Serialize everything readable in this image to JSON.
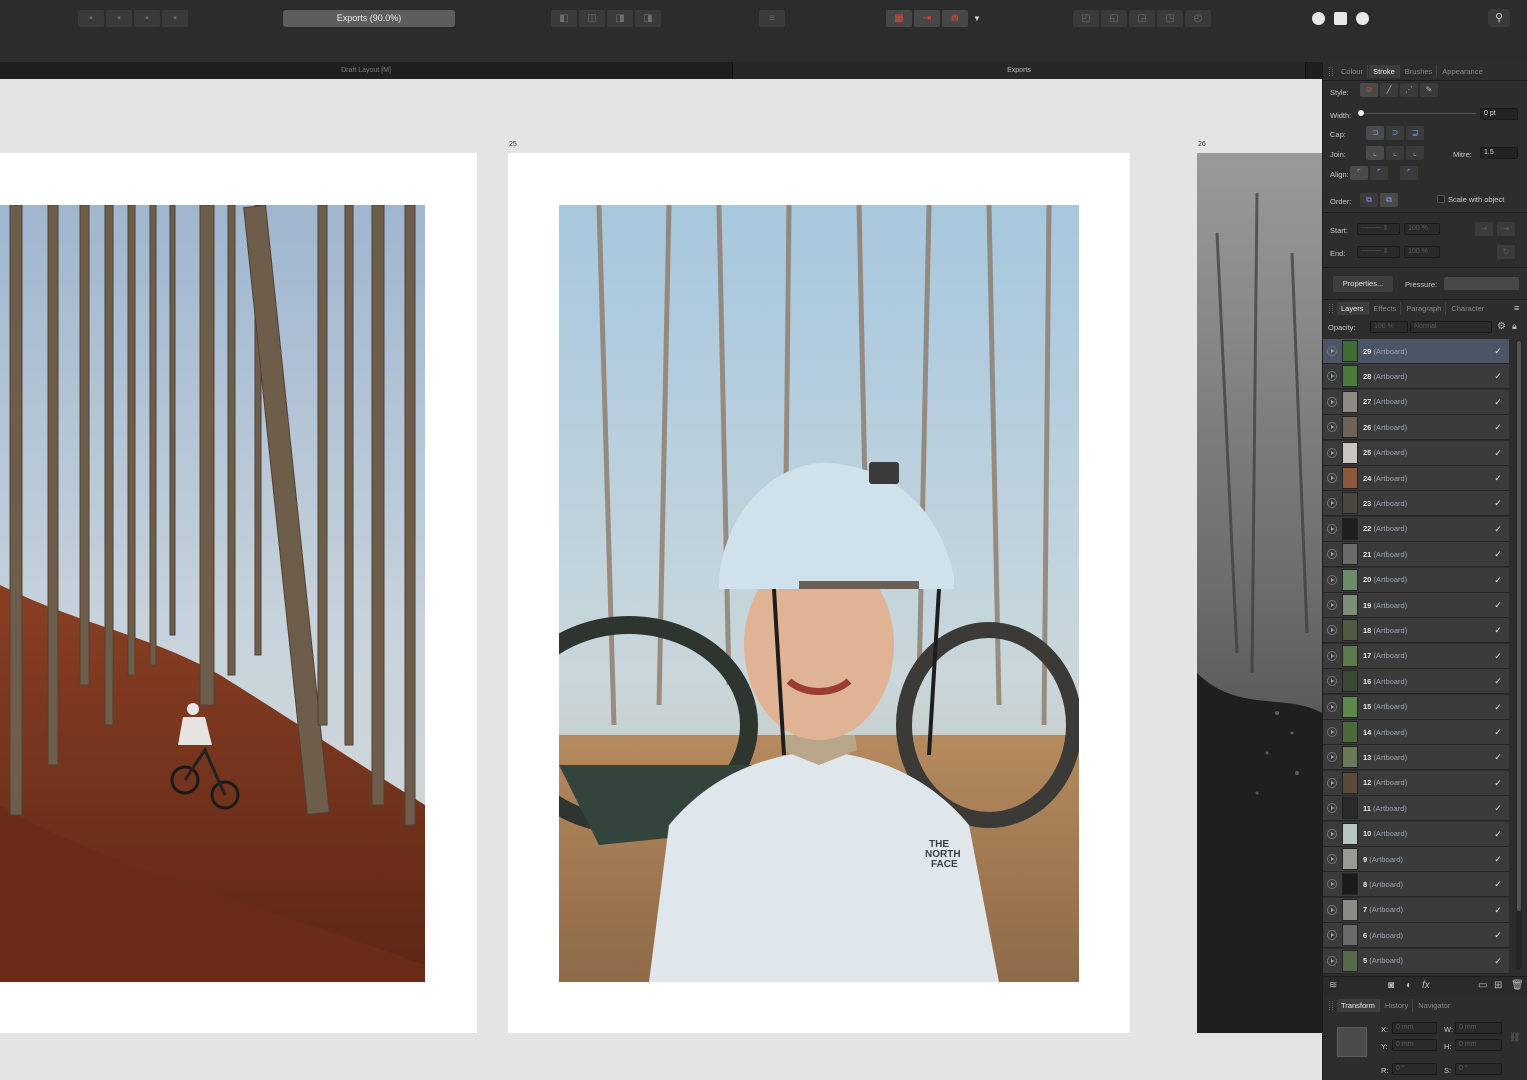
{
  "toolbar": {
    "export_persona": "Exports (90.0%)"
  },
  "tabs": [
    {
      "label": "Draft Layout [M]"
    },
    {
      "label": "Exports"
    }
  ],
  "canvas": {
    "page_labels": [
      "25",
      "26"
    ]
  },
  "stroke_panel": {
    "tabs": [
      "Colour",
      "Stroke",
      "Brushes",
      "Appearance"
    ],
    "active_tab": "Stroke",
    "style_label": "Style:",
    "width_label": "Width:",
    "width_value": "0 pt",
    "cap_label": "Cap:",
    "join_label": "Join:",
    "mitre_label": "Mitre:",
    "mitre_value": "1.5",
    "align_label": "Align:",
    "order_label": "Order:",
    "scale_label": "Scale with object",
    "start_label": "Start:",
    "end_label": "End:",
    "start_scale": "100 %",
    "end_scale": "100 %",
    "properties_label": "Properties...",
    "pressure_label": "Pressure:"
  },
  "layers_panel": {
    "tabs": [
      "Layers",
      "Effects",
      "Paragraph",
      "Character"
    ],
    "active_tab": "Layers",
    "opacity_label": "Opacity:",
    "opacity_value": "100 %",
    "blend_mode": "Normal",
    "layers": [
      {
        "name": "29",
        "type": "(Artboard)",
        "selected": true
      },
      {
        "name": "28",
        "type": "(Artboard)"
      },
      {
        "name": "27",
        "type": "(Artboard)"
      },
      {
        "name": "26",
        "type": "(Artboard)"
      },
      {
        "name": "25",
        "type": "(Artboard)"
      },
      {
        "name": "24",
        "type": "(Artboard)"
      },
      {
        "name": "23",
        "type": "(Artboard)"
      },
      {
        "name": "22",
        "type": "(Artboard)"
      },
      {
        "name": "21",
        "type": "(Artboard)"
      },
      {
        "name": "20",
        "type": "(Artboard)"
      },
      {
        "name": "19",
        "type": "(Artboard)"
      },
      {
        "name": "18",
        "type": "(Artboard)"
      },
      {
        "name": "17",
        "type": "(Artboard)"
      },
      {
        "name": "16",
        "type": "(Artboard)"
      },
      {
        "name": "15",
        "type": "(Artboard)"
      },
      {
        "name": "14",
        "type": "(Artboard)"
      },
      {
        "name": "13",
        "type": "(Artboard)"
      },
      {
        "name": "12",
        "type": "(Artboard)"
      },
      {
        "name": "11",
        "type": "(Artboard)"
      },
      {
        "name": "10",
        "type": "(Artboard)"
      },
      {
        "name": "9",
        "type": "(Artboard)"
      },
      {
        "name": "8",
        "type": "(Artboard)"
      },
      {
        "name": "7",
        "type": "(Artboard)"
      },
      {
        "name": "6",
        "type": "(Artboard)"
      },
      {
        "name": "5",
        "type": "(Artboard)"
      }
    ]
  },
  "transform_panel": {
    "tabs": [
      "Transform",
      "History",
      "Navigator"
    ],
    "active_tab": "Transform",
    "x_label": "X:",
    "x_value": "0 mm",
    "y_label": "Y:",
    "y_value": "0 mm",
    "w_label": "W:",
    "w_value": "0 mm",
    "h_label": "H:",
    "h_value": "0 mm",
    "r_label": "R:",
    "r_value": "0 °",
    "s_label": "S:",
    "s_value": "0 °"
  },
  "colors": {
    "toolbar_bg": "#2c2c2c",
    "panel_bg": "#2d2d2d",
    "canvas_bg": "#e4e4e4",
    "selected_layer": "#4b5566",
    "accent_blue": "#6fa6e8",
    "accent_red": "#d9463b"
  }
}
